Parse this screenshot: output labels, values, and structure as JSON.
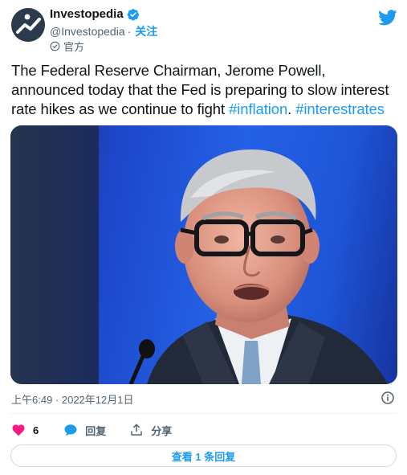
{
  "author": {
    "name": "Investopedia",
    "handle": "@Investopedia",
    "separator": "·",
    "follow_label": "关注",
    "official_label": "官方"
  },
  "tweet": {
    "text_before": "The Federal Reserve Chairman, Jerome Powell, announced today that the Fed is preparing to slow interest rate hikes as we continue to fight ",
    "hashtag1": "#inflation",
    "text_mid": ". ",
    "hashtag2": "#interestrates",
    "timestamp": "上午6:49 · 2022年12月1日"
  },
  "actions": {
    "like_count": "6",
    "reply_label": "回复",
    "share_label": "分享",
    "view_replies_label": "查看 1 条回复"
  },
  "icons": {
    "avatar": "investopedia-logo",
    "verified": "verified-badge-icon",
    "official": "official-badge-icon",
    "brand": "twitter-bird-icon",
    "info": "info-icon",
    "like": "heart-icon",
    "reply": "comment-bubble-icon",
    "share": "share-upload-icon"
  },
  "colors": {
    "accent": "#1d9bf0",
    "like": "#f91880",
    "text": "#0f1419",
    "muted": "#536471"
  }
}
